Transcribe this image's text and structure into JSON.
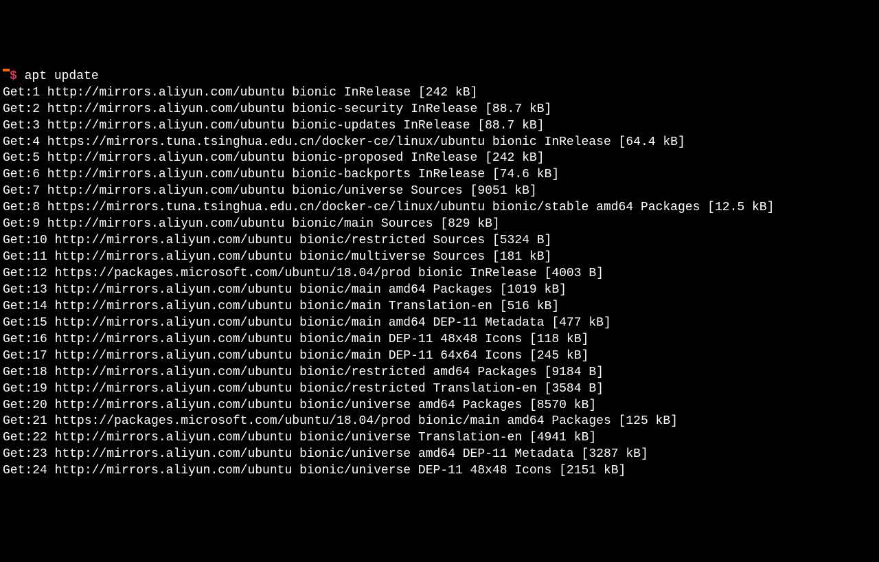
{
  "prompt": {
    "symbol": "$",
    "command": "apt update"
  },
  "lines": [
    "Get:1 http://mirrors.aliyun.com/ubuntu bionic InRelease [242 kB]",
    "Get:2 http://mirrors.aliyun.com/ubuntu bionic-security InRelease [88.7 kB]",
    "Get:3 http://mirrors.aliyun.com/ubuntu bionic-updates InRelease [88.7 kB]",
    "Get:4 https://mirrors.tuna.tsinghua.edu.cn/docker-ce/linux/ubuntu bionic InRelease [64.4 kB]",
    "Get:5 http://mirrors.aliyun.com/ubuntu bionic-proposed InRelease [242 kB]",
    "Get:6 http://mirrors.aliyun.com/ubuntu bionic-backports InRelease [74.6 kB]",
    "Get:7 http://mirrors.aliyun.com/ubuntu bionic/universe Sources [9051 kB]",
    "Get:8 https://mirrors.tuna.tsinghua.edu.cn/docker-ce/linux/ubuntu bionic/stable amd64 Packages [12.5 kB]",
    "Get:9 http://mirrors.aliyun.com/ubuntu bionic/main Sources [829 kB]",
    "Get:10 http://mirrors.aliyun.com/ubuntu bionic/restricted Sources [5324 B]",
    "Get:11 http://mirrors.aliyun.com/ubuntu bionic/multiverse Sources [181 kB]",
    "Get:12 https://packages.microsoft.com/ubuntu/18.04/prod bionic InRelease [4003 B]",
    "Get:13 http://mirrors.aliyun.com/ubuntu bionic/main amd64 Packages [1019 kB]",
    "Get:14 http://mirrors.aliyun.com/ubuntu bionic/main Translation-en [516 kB]",
    "Get:15 http://mirrors.aliyun.com/ubuntu bionic/main amd64 DEP-11 Metadata [477 kB]",
    "Get:16 http://mirrors.aliyun.com/ubuntu bionic/main DEP-11 48x48 Icons [118 kB]",
    "Get:17 http://mirrors.aliyun.com/ubuntu bionic/main DEP-11 64x64 Icons [245 kB]",
    "Get:18 http://mirrors.aliyun.com/ubuntu bionic/restricted amd64 Packages [9184 B]",
    "Get:19 http://mirrors.aliyun.com/ubuntu bionic/restricted Translation-en [3584 B]",
    "Get:20 http://mirrors.aliyun.com/ubuntu bionic/universe amd64 Packages [8570 kB]",
    "Get:21 https://packages.microsoft.com/ubuntu/18.04/prod bionic/main amd64 Packages [125 kB]",
    "Get:22 http://mirrors.aliyun.com/ubuntu bionic/universe Translation-en [4941 kB]",
    "Get:23 http://mirrors.aliyun.com/ubuntu bionic/universe amd64 DEP-11 Metadata [3287 kB]",
    "Get:24 http://mirrors.aliyun.com/ubuntu bionic/universe DEP-11 48x48 Icons [2151 kB]"
  ]
}
